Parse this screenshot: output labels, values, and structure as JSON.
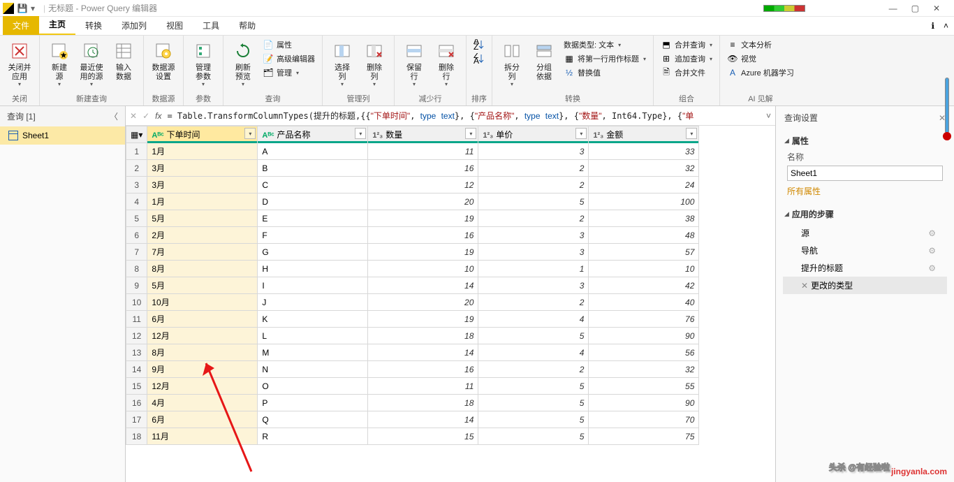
{
  "window": {
    "title": "无标题 - Power Query 编辑器"
  },
  "tabs": {
    "file": "文件",
    "home": "主页",
    "transform": "转换",
    "add": "添加列",
    "view": "视图",
    "tools": "工具",
    "help": "帮助"
  },
  "ribbon": {
    "close": {
      "label": "关闭并\n应用",
      "group": "关闭"
    },
    "new_query": {
      "new_source": "新建\n源",
      "recent": "最近使\n用的源",
      "enter": "输入\n数据",
      "group": "新建查询"
    },
    "data_source": {
      "settings": "数据源\n设置",
      "group": "数据源"
    },
    "params": {
      "manage": "管理\n参数",
      "group": "参数"
    },
    "query": {
      "refresh": "刷新\n预览",
      "props": "属性",
      "adv": "高级编辑器",
      "mng": "管理",
      "group": "查询"
    },
    "manage_cols": {
      "choose": "选择\n列",
      "remove": "删除\n列",
      "group": "管理列"
    },
    "reduce": {
      "keep": "保留\n行",
      "remove": "删除\n行",
      "group": "减少行"
    },
    "sort": {
      "group": "排序"
    },
    "trans": {
      "split": "拆分\n列",
      "group_by": "分组\n依据",
      "dtype": "数据类型: 文本",
      "first_row": "将第一行用作标题",
      "replace": "替换值",
      "group": "转换"
    },
    "combine": {
      "merge": "合并查询",
      "append": "追加查询",
      "files": "合并文件",
      "group": "组合"
    },
    "ai": {
      "text": "文本分析",
      "vision": "视觉",
      "azure": "Azure 机器学习",
      "group": "AI 见解"
    }
  },
  "left": {
    "head": "查询 [1]",
    "item1": "Sheet1"
  },
  "formula": {
    "raw": "= Table.TransformColumnTypes(提升的标题,{{\"下单时间\", type text}, {\"产品名称\", type text}, {\"数量\", Int64.Type}, {\"单",
    "parts": [
      "= Table.TransformColumnTypes(提升的标题,{{",
      "\"下单时间\"",
      ", ",
      "type",
      " ",
      "text",
      "}, {",
      "\"产品名称\"",
      ", ",
      "type",
      " ",
      "text",
      "}, {",
      "\"数量\"",
      ", Int64.Type}, {",
      "\"单"
    ]
  },
  "headers": {
    "c1": "下单时间",
    "c2": "产品名称",
    "c3": "数量",
    "c4": "单价",
    "c5": "金额"
  },
  "type_icons": {
    "text": "Aᴮᶜ",
    "num": "1²₃"
  },
  "rows": [
    {
      "n": 1,
      "t": "1月",
      "p": "A",
      "q": 11,
      "u": 3,
      "a": 33
    },
    {
      "n": 2,
      "t": "3月",
      "p": "B",
      "q": 16,
      "u": 2,
      "a": 32
    },
    {
      "n": 3,
      "t": "3月",
      "p": "C",
      "q": 12,
      "u": 2,
      "a": 24
    },
    {
      "n": 4,
      "t": "1月",
      "p": "D",
      "q": 20,
      "u": 5,
      "a": 100
    },
    {
      "n": 5,
      "t": "5月",
      "p": "E",
      "q": 19,
      "u": 2,
      "a": 38
    },
    {
      "n": 6,
      "t": "2月",
      "p": "F",
      "q": 16,
      "u": 3,
      "a": 48
    },
    {
      "n": 7,
      "t": "7月",
      "p": "G",
      "q": 19,
      "u": 3,
      "a": 57
    },
    {
      "n": 8,
      "t": "8月",
      "p": "H",
      "q": 10,
      "u": 1,
      "a": 10
    },
    {
      "n": 9,
      "t": "5月",
      "p": "I",
      "q": 14,
      "u": 3,
      "a": 42
    },
    {
      "n": 10,
      "t": "10月",
      "p": "J",
      "q": 20,
      "u": 2,
      "a": 40
    },
    {
      "n": 11,
      "t": "6月",
      "p": "K",
      "q": 19,
      "u": 4,
      "a": 76
    },
    {
      "n": 12,
      "t": "12月",
      "p": "L",
      "q": 18,
      "u": 5,
      "a": 90
    },
    {
      "n": 13,
      "t": "8月",
      "p": "M",
      "q": 14,
      "u": 4,
      "a": 56
    },
    {
      "n": 14,
      "t": "9月",
      "p": "N",
      "q": 16,
      "u": 2,
      "a": 32
    },
    {
      "n": 15,
      "t": "12月",
      "p": "O",
      "q": 11,
      "u": 5,
      "a": 55
    },
    {
      "n": 16,
      "t": "4月",
      "p": "P",
      "q": 18,
      "u": 5,
      "a": 90
    },
    {
      "n": 17,
      "t": "6月",
      "p": "Q",
      "q": 14,
      "u": 5,
      "a": 70
    },
    {
      "n": 18,
      "t": "11月",
      "p": "R",
      "q": 15,
      "u": 5,
      "a": 75
    }
  ],
  "right": {
    "title": "查询设置",
    "props_h": "属性",
    "name_lbl": "名称",
    "name_val": "Sheet1",
    "all_props": "所有属性",
    "steps_h": "应用的步骤",
    "steps": [
      "源",
      "导航",
      "提升的标题",
      "更改的类型"
    ],
    "selected_step": 3
  },
  "watermark": {
    "txt": "头杀 @有经验啦",
    "sub": "jingyanla.com"
  }
}
